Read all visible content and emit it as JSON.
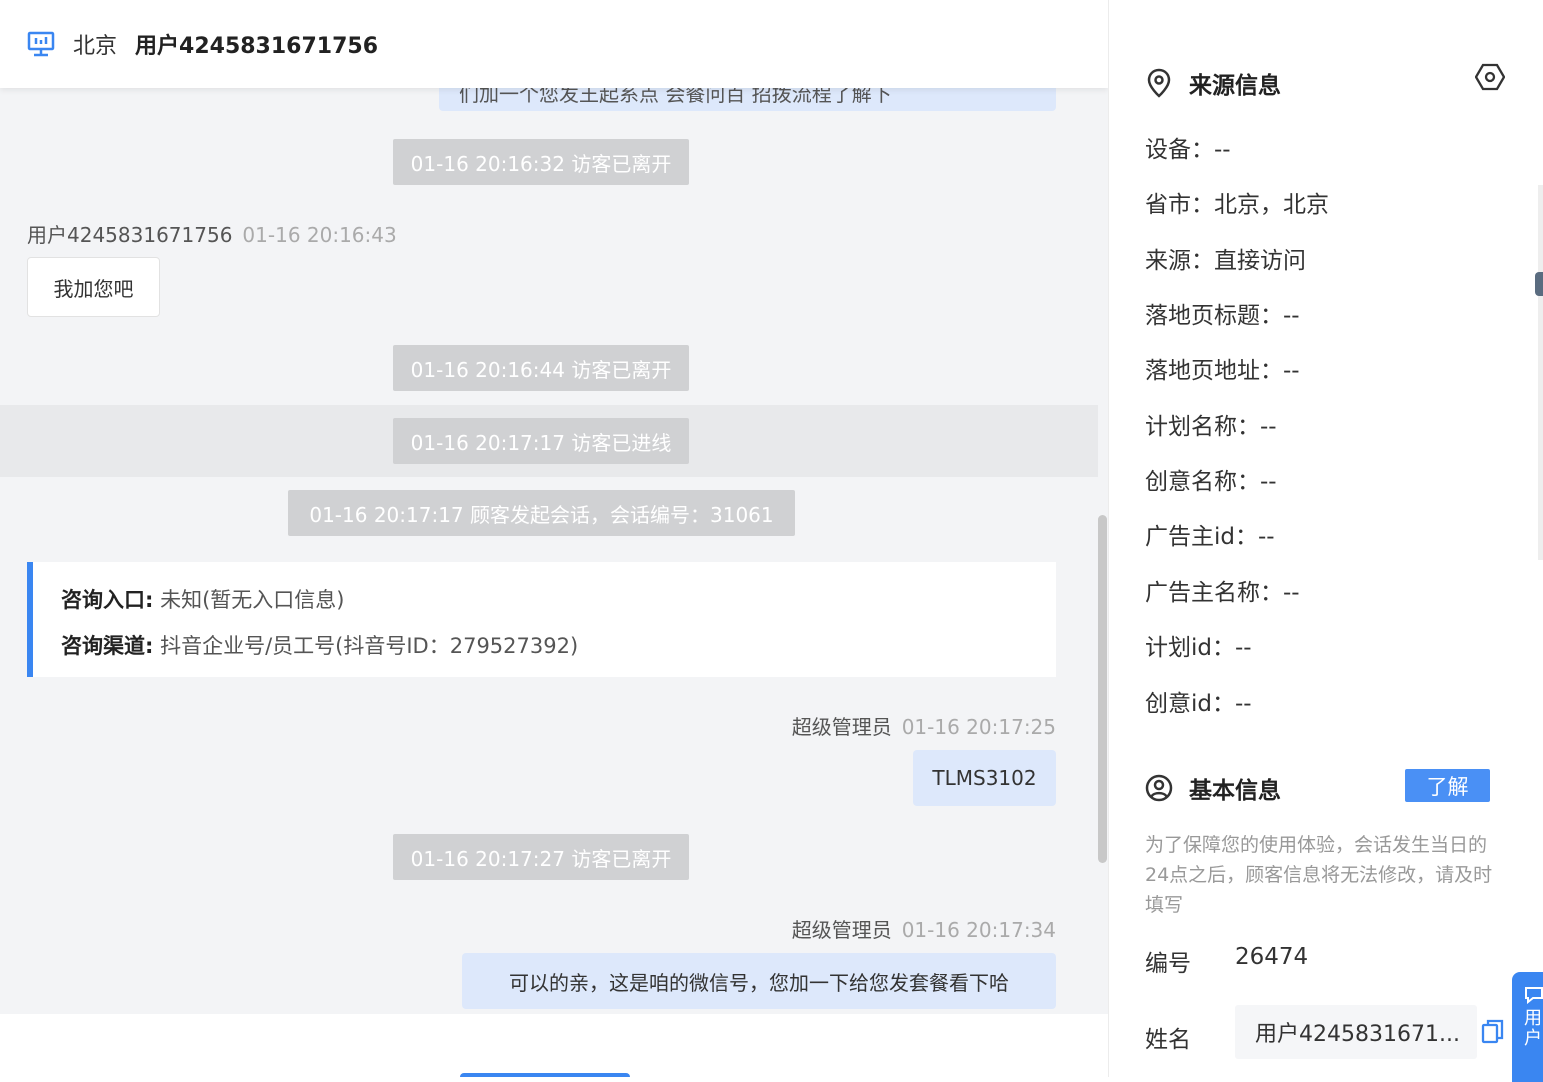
{
  "header": {
    "location": "北京",
    "user_name": "用户4245831671756"
  },
  "chat": {
    "partial_message": "们加一个您发王起系点 会餐问百 招拨流程了解下",
    "system_events": [
      "01-16 20:16:32 访客已离开",
      "01-16 20:16:44 访客已离开",
      "01-16 20:17:17 访客已进线",
      "01-16 20:17:17 顾客发起会话，会话编号：31061",
      "01-16 20:17:27 访客已离开"
    ],
    "visitor_message": {
      "sender": "用户4245831671756",
      "time": "01-16 20:16:43",
      "text": "我加您吧"
    },
    "consult_info": {
      "entry_label": "咨询入口:",
      "entry_value": "未知(暂无入口信息)",
      "channel_label": "咨询渠道:",
      "channel_value": "抖音企业号/员工号(抖音号ID：279527392)"
    },
    "agent_messages": [
      {
        "sender": "超级管理员",
        "time": "01-16 20:17:25",
        "text": "TLMS3102"
      },
      {
        "sender": "超级管理员",
        "time": "01-16 20:17:34",
        "text": "可以的亲，这是咱的微信号，您加一下给您发套餐看下哈"
      }
    ]
  },
  "source_info": {
    "title": "来源信息",
    "fields": [
      "设备：--",
      "省市：北京，北京",
      "来源：直接访问",
      "落地页标题：--",
      "落地页地址：--",
      "计划名称：--",
      "创意名称：--",
      "广告主id：--",
      "广告主名称：--",
      "计划id：--",
      "创意id：--"
    ]
  },
  "basic_info": {
    "title": "基本信息",
    "learn_button": "了解",
    "notice": "为了保障您的使用体验，会话发生当日的24点之后，顾客信息将无法修改，请及时填写",
    "id_label": "编号",
    "id_value": "26474",
    "name_label": "姓名",
    "name_value": "用户4245831671..."
  },
  "float_button": {
    "line1": "用",
    "line2": "户"
  },
  "colors": {
    "accent": "#3a86f1",
    "agent_bubble": "#dde8fb",
    "system_pill": "#d0d1d3"
  }
}
